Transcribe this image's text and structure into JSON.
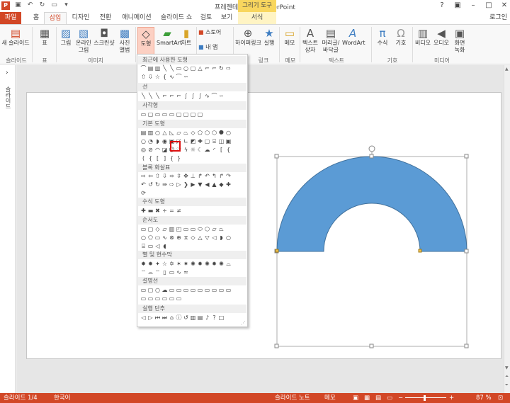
{
  "window": {
    "title": "프레젠테이션2 - PowerPoint",
    "context_tab": "그리기 도구",
    "app_icon": "P",
    "login": "로그인"
  },
  "tabs": {
    "file": "파일",
    "home": "홈",
    "insert": "삽입",
    "design": "디자인",
    "transitions": "전환",
    "animations": "애니메이션",
    "slideshow": "슬라이드 쇼",
    "review": "검토",
    "view": "보기",
    "format": "서식"
  },
  "ribbon": {
    "new_slide": "새 슬라이드",
    "table": "표",
    "picture": "그림",
    "online_picture_1": "온라인",
    "online_picture_2": "그림",
    "screenshot": "스크린샷",
    "album_1": "사진",
    "album_2": "앨범",
    "shapes": "도형",
    "smartart": "SmartArt",
    "chart": "차트",
    "store": "스토어",
    "my_apps": "내 앱",
    "hyperlink": "하이퍼링크",
    "action": "실행",
    "comment": "메모",
    "textbox_1": "텍스트",
    "textbox_2": "상자",
    "header_1": "머리글/",
    "header_2": "바닥글",
    "wordart": "WordArt",
    "equation": "수식",
    "symbol": "기호",
    "video": "비디오",
    "audio": "오디오",
    "screen_rec_1": "화면",
    "screen_rec_2": "녹화",
    "groups": {
      "slides": "슬라이드",
      "tables": "표",
      "images": "이미지",
      "link": "링크",
      "comments": "메모",
      "text": "텍스트",
      "symbols": "기호",
      "media": "미디어"
    }
  },
  "left_pane": {
    "label": "슬라이드"
  },
  "dropdown": {
    "sections": {
      "recent": "최근에 사용한 도형",
      "lines": "선",
      "rectangles": "사각형",
      "basic": "기본 도형",
      "block_arrows": "블록 화살표",
      "equation": "수식 도형",
      "flowchart": "순서도",
      "stars": "별 및 현수막",
      "callouts": "설명선",
      "action_buttons": "실행 단추"
    }
  },
  "shape": {
    "fill": "#5b9bd5",
    "stroke": "#41719c"
  },
  "status": {
    "slide_info": "슬라이드 1/4",
    "language": "한국어",
    "notes": "슬라이드 노트",
    "comments": "메모",
    "zoom": "87 %"
  }
}
